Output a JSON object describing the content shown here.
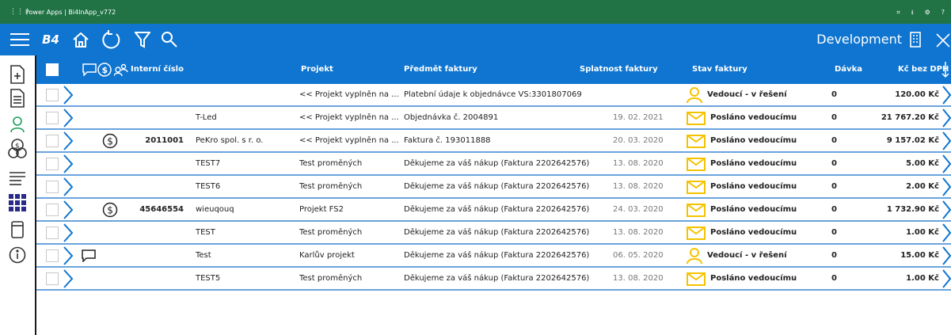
{
  "titlebar": {
    "waffle": "⋮⋮⋮",
    "title": "Power Apps | Bi4InApp_v772"
  },
  "appbar": {
    "logo": "B4",
    "environment": "Development"
  },
  "colors": {
    "titlebar": "#217346",
    "accent": "#0f75d0",
    "row_divider": "#6aa4dd",
    "envelope": "#f4c300",
    "person": "#f4c300"
  },
  "columns": {
    "interni_cislo": "Interní číslo",
    "projekt": "Projekt",
    "predmet": "Předmět faktury",
    "splatnost": "Splatnost faktury",
    "stav": "Stav faktury",
    "davka": "Dávka",
    "kc": "Kč bez DPH"
  },
  "rows": [
    {
      "dollar": false,
      "comment": false,
      "number": "",
      "company": "",
      "project": "<< Projekt vyplněn na ...",
      "subject": "Platební údaje k objednávce VS:3301807069",
      "date": "",
      "status_icon": "person-icon",
      "status": "Vedoucí - v řešení",
      "davka": "0",
      "amount": "120.00 Kč"
    },
    {
      "dollar": false,
      "comment": false,
      "number": "",
      "company": "T-Led",
      "project": "<< Projekt vyplněn na ...",
      "subject": "Objednávka č. 2004891",
      "date": "19. 02. 2021",
      "status_icon": "envelope-icon",
      "status": "Posláno vedoucímu",
      "davka": "0",
      "amount": "21 767.20 Kč"
    },
    {
      "dollar": true,
      "comment": false,
      "number": "2011001",
      "company": "PeKro spol. s r. o.",
      "project": "<< Projekt vyplněn na ...",
      "subject": "Faktura č. 193011888",
      "date": "20. 03. 2020",
      "status_icon": "envelope-icon",
      "status": "Posláno vedoucímu",
      "davka": "0",
      "amount": "9 157.02 Kč"
    },
    {
      "dollar": false,
      "comment": false,
      "number": "",
      "company": "TEST7",
      "project": "Test proměných",
      "subject": "Děkujeme za váš nákup (Faktura 2202642576)",
      "date": "13. 08. 2020",
      "status_icon": "envelope-icon",
      "status": "Posláno vedoucímu",
      "davka": "0",
      "amount": "5.00 Kč"
    },
    {
      "dollar": false,
      "comment": false,
      "number": "",
      "company": "TEST6",
      "project": "Test proměných",
      "subject": "Děkujeme za váš nákup (Faktura 2202642576)",
      "date": "13. 08. 2020",
      "status_icon": "envelope-icon",
      "status": "Posláno vedoucímu",
      "davka": "0",
      "amount": "2.00 Kč"
    },
    {
      "dollar": true,
      "comment": false,
      "number": "45646554",
      "company": "wieuqouq",
      "project": "Projekt FS2",
      "subject": "Děkujeme za váš nákup (Faktura 2202642576)",
      "date": "24. 03. 2020",
      "status_icon": "envelope-icon",
      "status": "Posláno vedoucímu",
      "davka": "0",
      "amount": "1 732.90 Kč"
    },
    {
      "dollar": false,
      "comment": false,
      "number": "",
      "company": "TEST",
      "project": "Test proměných",
      "subject": "Děkujeme za váš nákup (Faktura 2202642576)",
      "date": "13. 08. 2020",
      "status_icon": "envelope-icon",
      "status": "Posláno vedoucímu",
      "davka": "0",
      "amount": "1.00 Kč"
    },
    {
      "dollar": false,
      "comment": true,
      "number": "",
      "company": "Test",
      "project": "Karlův projekt",
      "subject": "Děkujeme za váš nákup (Faktura 2202642576)",
      "date": "06. 05. 2020",
      "status_icon": "person-icon",
      "status": "Vedoucí - v řešení",
      "davka": "0",
      "amount": "15.00 Kč"
    },
    {
      "dollar": false,
      "comment": false,
      "number": "",
      "company": "TEST5",
      "project": "Test proměných",
      "subject": "Děkujeme za váš nákup (Faktura 2202642576)",
      "date": "13. 08. 2020",
      "status_icon": "envelope-icon",
      "status": "Posláno vedoucímu",
      "davka": "0",
      "amount": "1.00 Kč"
    }
  ]
}
